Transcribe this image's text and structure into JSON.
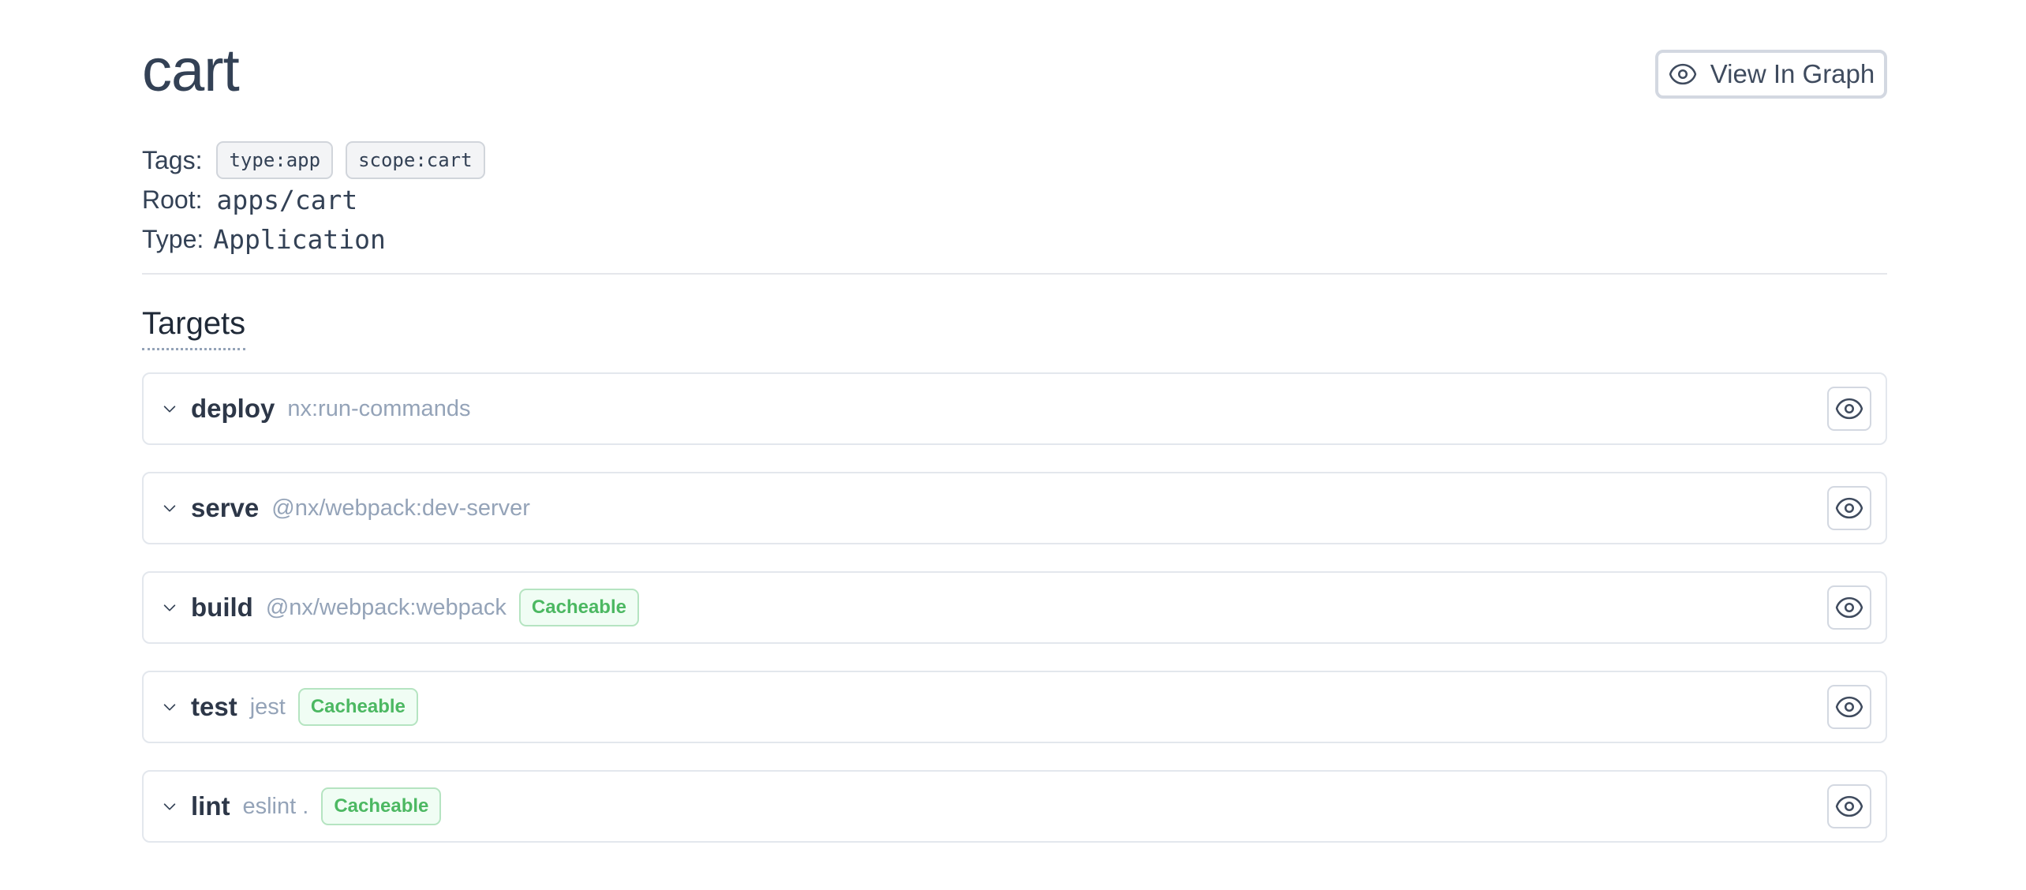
{
  "project": {
    "name": "cart",
    "view_in_graph_label": "View In Graph",
    "tags_label": "Tags:",
    "tags": [
      "type:app",
      "scope:cart"
    ],
    "root_label": "Root:",
    "root": "apps/cart",
    "type_label": "Type:",
    "type": "Application"
  },
  "targets_section": {
    "title": "Targets",
    "items": [
      {
        "name": "deploy",
        "executor": "nx:run-commands",
        "badge": null
      },
      {
        "name": "serve",
        "executor": "@nx/webpack:dev-server",
        "badge": null
      },
      {
        "name": "build",
        "executor": "@nx/webpack:webpack",
        "badge": "Cacheable"
      },
      {
        "name": "test",
        "executor": "jest",
        "badge": "Cacheable"
      },
      {
        "name": "lint",
        "executor": "eslint .",
        "badge": "Cacheable"
      }
    ]
  },
  "icons": {
    "view_graph": "eye-icon",
    "expand": "chevron-down-icon",
    "target_view": "eye-icon"
  },
  "colors": {
    "text": "#334155",
    "muted": "#94a3b8",
    "cacheable_text": "#4cb862",
    "cacheable_bg": "#f0fdf4",
    "border": "#e3e7ed"
  }
}
